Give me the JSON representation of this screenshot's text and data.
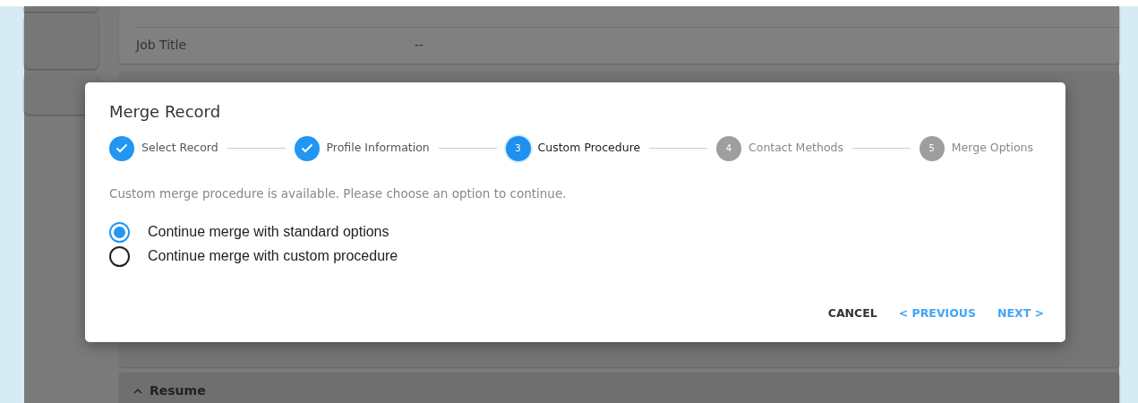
{
  "background": {
    "fields": [
      {
        "label": "Job Title",
        "value": "--"
      }
    ],
    "section": {
      "title": "Resume",
      "expanded": true
    }
  },
  "dialog": {
    "title": "Merge Record",
    "steps": [
      {
        "label": "Select Record",
        "completed": true,
        "current": false
      },
      {
        "label": "Profile Information",
        "completed": true,
        "current": false
      },
      {
        "number": "3",
        "label": "Custom Procedure",
        "completed": false,
        "current": true
      },
      {
        "number": "4",
        "label": "Contact Methods",
        "completed": false,
        "current": false
      },
      {
        "number": "5",
        "label": "Merge Options",
        "completed": false,
        "current": false
      }
    ],
    "message": "Custom merge procedure is available. Please choose an option to continue.",
    "options": [
      {
        "label": "Continue merge with standard options",
        "selected": true
      },
      {
        "label": "Continue merge with custom procedure",
        "selected": false
      }
    ],
    "buttons": [
      {
        "label": "CANCEL",
        "kind": "plain"
      },
      {
        "label": "< PREVIOUS",
        "kind": "link"
      },
      {
        "label": "NEXT >",
        "kind": "link"
      }
    ]
  }
}
